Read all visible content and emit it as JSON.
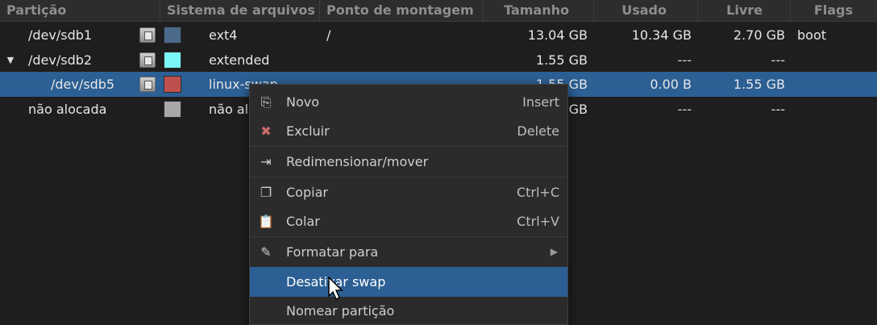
{
  "columns": {
    "particao": "Partição",
    "sistema": "Sistema de arquivos",
    "ponto": "Ponto de montagem",
    "tamanho": "Tamanho",
    "usado": "Usado",
    "livre": "Livre",
    "flags": "Flags"
  },
  "rows": [
    {
      "partition": "/dev/sdb1",
      "fs": "ext4",
      "mount": "/",
      "size": "13.04 GB",
      "used": "10.34 GB",
      "free": "2.70 GB",
      "flags": "boot",
      "color": "#4c6a8c"
    },
    {
      "partition": "/dev/sdb2",
      "fs": "extended",
      "mount": "",
      "size": "1.55 GB",
      "used": "---",
      "free": "---",
      "flags": "",
      "color": "#7cf7f7"
    },
    {
      "partition": "/dev/sdb5",
      "fs": "linux-swap",
      "mount": "",
      "size": "1.55 GB",
      "used": "0.00 B",
      "free": "1.55 GB",
      "flags": "",
      "color": "#c0504f"
    },
    {
      "partition": "não alocada",
      "fs": "não alocada",
      "mount": "",
      "size": "0.00 GB",
      "used": "---",
      "free": "---",
      "flags": "",
      "color": "#a8a8a8"
    }
  ],
  "menu": {
    "novo": {
      "label": "Novo",
      "accel": "Insert"
    },
    "excluir": {
      "label": "Excluir",
      "accel": "Delete"
    },
    "redimensionar": {
      "label": "Redimensionar/mover"
    },
    "copiar": {
      "label": "Copiar",
      "accel": "Ctrl+C"
    },
    "colar": {
      "label": "Colar",
      "accel": "Ctrl+V"
    },
    "formatar": {
      "label": "Formatar para"
    },
    "desativar": {
      "label": "Desativar swap"
    },
    "nomear": {
      "label": "Nomear partição"
    }
  },
  "colors": {
    "selection": "#2c5f94",
    "background": "#1e1e1e",
    "header": "#2d2d2d"
  }
}
